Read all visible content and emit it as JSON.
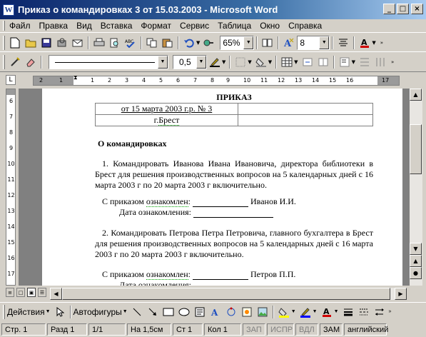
{
  "window": {
    "title": "Приказ о командировках 3 от 15.03.2003 - Microsoft Word",
    "app_letter": "W",
    "controls": [
      "_",
      "□",
      "×"
    ]
  },
  "menubar": {
    "items": [
      "Файл",
      "Правка",
      "Вид",
      "Вставка",
      "Формат",
      "Сервис",
      "Таблица",
      "Окно",
      "Справка"
    ]
  },
  "toolbar": {
    "zoom": "65%",
    "font_size": "8",
    "line_weight": "0,5",
    "icons": [
      "new-icon",
      "open-icon",
      "save-icon",
      "permission-icon",
      "mail-icon",
      "print-icon",
      "preview-icon",
      "spelling-icon",
      "copy-icon",
      "paste-icon",
      "undo-icon",
      "hyperlink-icon",
      "read-icon",
      "align-center-icon",
      "font-color-icon"
    ]
  },
  "ruler": {
    "h_ticks": [
      "2",
      "1",
      "1",
      "2",
      "3",
      "4",
      "5",
      "6",
      "7",
      "8",
      "9",
      "10",
      "11",
      "12",
      "13",
      "14",
      "15",
      "16",
      "17",
      "18"
    ],
    "v_ticks": [
      "6",
      "7",
      "8",
      "9",
      "10",
      "11",
      "12",
      "13",
      "14",
      "15",
      "16",
      "17"
    ]
  },
  "document": {
    "title": "ПРИКАЗ",
    "header_row1": "от 15 марта 2003 г.р. № 3",
    "header_row2_pre": "г.",
    "header_row2_city": "Брест",
    "heading": "О командировках",
    "para1": "1. Командировать Иванова Ивана Ивановича, директора библиотеки в Брест для решения производственных вопросов на 5 календарных дней с 16 марта 2003 г по 20 марта 2003 г включительно.",
    "sign1_pre": "С приказом",
    "sign1_word": "ознакомлен",
    "sign1_colon": ":",
    "sign1_name": "Иванов И.И.",
    "date_label": "Дата ознакомления:",
    "para2": "2. Командировать Петрова Петра Петровича, главного бухгалтера в Брест для решения производственных вопросов на 5 календарных дней с 16 марта 2003 г по 20 марта 2003 г включительно.",
    "sign2_pre": "С приказом",
    "sign2_word": "ознакомлен",
    "sign2_colon": ":",
    "sign2_name": "Петров П.П.",
    "date_label2": "Дата ознакомления:"
  },
  "drawbar": {
    "actions": "Действия",
    "autoshapes": "Автофигуры"
  },
  "status": {
    "page": "Стр. 1",
    "section": "Разд 1",
    "pages": "1/1",
    "at": "На 1,5см",
    "line": "Ст 1",
    "col": "Кол 1",
    "rec": "ЗАП",
    "trk": "ИСПР",
    "ext": "ВДЛ",
    "ovr": "ЗАМ",
    "lang": "английский"
  }
}
